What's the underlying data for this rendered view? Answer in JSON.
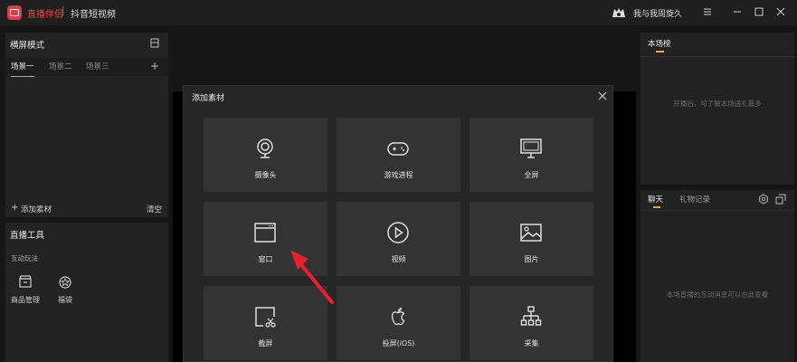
{
  "titlebar": {
    "app_name": "直播伴侣",
    "separator": "|",
    "subtitle": "抖音短视频",
    "user_name": "我与我周旋久"
  },
  "left_panel": {
    "title": "横屏模式",
    "scenes": [
      "场景一",
      "场景二",
      "场景三"
    ],
    "active_scene": "场景一",
    "add_material": "添加素材",
    "clear": "清空"
  },
  "tools": {
    "title": "直播工具",
    "section": "互动玩法",
    "items": [
      {
        "label": "商品管理",
        "icon": "shop-icon"
      },
      {
        "label": "福袋",
        "icon": "lucky-bag-icon"
      }
    ]
  },
  "dialog": {
    "title": "添加素材",
    "tiles": [
      {
        "label": "摄像头",
        "icon": "camera-icon"
      },
      {
        "label": "游戏进程",
        "icon": "gamepad-icon"
      },
      {
        "label": "全屏",
        "icon": "monitor-icon"
      },
      {
        "label": "窗口",
        "icon": "window-icon"
      },
      {
        "label": "视频",
        "icon": "play-icon"
      },
      {
        "label": "图片",
        "icon": "image-icon"
      },
      {
        "label": "截屏",
        "icon": "screenshot-icon"
      },
      {
        "label": "投屏(iOS)",
        "icon": "apple-icon"
      },
      {
        "label": "采集",
        "icon": "capture-icon"
      }
    ]
  },
  "right_panel": {
    "leaderboard_tab": "本场榜",
    "leaderboard_hint": "开播后，可了解本场送礼最多",
    "chat_tab": "聊天",
    "gift_tab": "礼物记录",
    "chat_hint": "本场直播的互动消息可以在此查看"
  },
  "colors": {
    "accent": "#f5a623",
    "brand": "#e63946",
    "arrow": "#e8202a"
  }
}
